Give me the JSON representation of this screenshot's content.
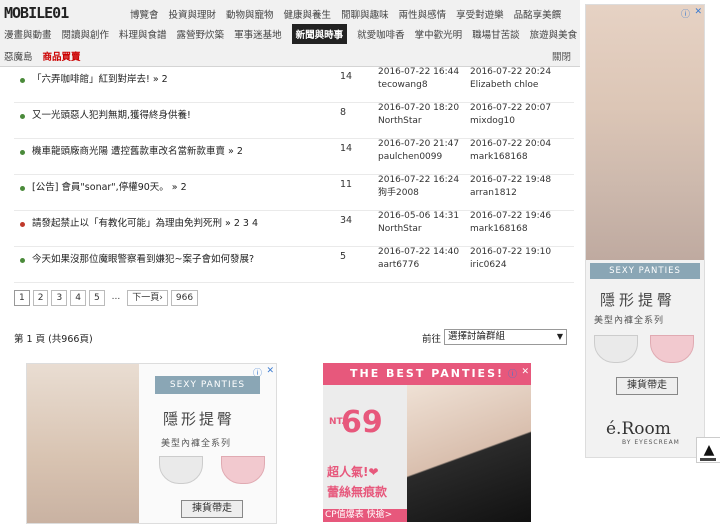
{
  "header": {
    "logo": "MOBILE01",
    "nav1": [
      "博覽會",
      "投資與理財",
      "動物與寵物",
      "健康與養生",
      "閒聊與趣味",
      "兩性與感情",
      "享受對遊樂",
      "品酩享美饌"
    ],
    "nav2": [
      "漫畫與動畫",
      "閱讀與創作",
      "料理與食譜",
      "露營野炊築",
      "軍事迷基地",
      "新聞與時事",
      "就愛咖啡香",
      "掌中歡光明",
      "職場甘苦談",
      "旅遊與美食"
    ],
    "nav3": [
      "惡魔島",
      "商品買賣"
    ],
    "close_label": "關閉"
  },
  "topics": [
    {
      "title": "「六弄咖啡館」紅到對岸去! » 2",
      "replies": "14",
      "created": "2016-07-22 16:44",
      "author": "tecowang8",
      "last_time": "2016-07-22 20:24",
      "last_user": "Elizabeth chloe",
      "dot": "green"
    },
    {
      "title": "又一光頭惡人犯判無期,獲得終身供養!",
      "replies": "8",
      "created": "2016-07-20 18:20",
      "author": "NorthStar",
      "last_time": "2016-07-22 20:07",
      "last_user": "mixdog10",
      "dot": "green"
    },
    {
      "title": "機車龍頭廠商光陽 遭控舊款車改名當新款車賣 » 2",
      "replies": "14",
      "created": "2016-07-20 21:47",
      "author": "paulchen0099",
      "last_time": "2016-07-22 20:04",
      "last_user": "mark168168",
      "dot": "green"
    },
    {
      "title": "[公告] 會員\"sonar\",停權90天。 » 2",
      "replies": "11",
      "created": "2016-07-22 16:24",
      "author": "狗手2008",
      "last_time": "2016-07-22 19:48",
      "last_user": "arran1812",
      "dot": "green"
    },
    {
      "title": "請發起禁止以「有教化可能」為理由免判死刑 » 2 3 4",
      "replies": "34",
      "created": "2016-05-06 14:31",
      "author": "NorthStar",
      "last_time": "2016-07-22 19:46",
      "last_user": "mark168168",
      "dot": "red"
    },
    {
      "title": "今天如果沒那位魔眼警察看到嫌犯~案子會如何發展?",
      "replies": "5",
      "created": "2016-07-22 14:40",
      "author": "aart6776",
      "last_time": "2016-07-22 19:10",
      "last_user": "iric0624",
      "dot": "green"
    }
  ],
  "pager": {
    "pages": [
      "1",
      "2",
      "3",
      "4",
      "5"
    ],
    "dots": "...",
    "next": "下一頁›",
    "last": "966"
  },
  "totals": "第 1 頁 (共966頁)",
  "goto_label": "前往",
  "select_value": "選擇討論群組",
  "ad1": {
    "band": "SEXY PANTIES",
    "title": "隱形提臀",
    "sub": "美型內褲全系列",
    "button": "揀貨帶走"
  },
  "ad2": {
    "top": "THE BEST PANTIES!",
    "nt": "NT.",
    "price": "69",
    "line1": "超人氣!❤",
    "line2": "蕾絲無痕款",
    "bottom": "CP值爆表 快搶>"
  },
  "side": {
    "band": "SEXY PANTIES",
    "title": "隱形提臀",
    "sub": "美型內褲全系列",
    "button": "揀貨帶走",
    "logo": "é.Room",
    "logo_sub": "BY EYESCREAM"
  },
  "scroll_top": "▲"
}
